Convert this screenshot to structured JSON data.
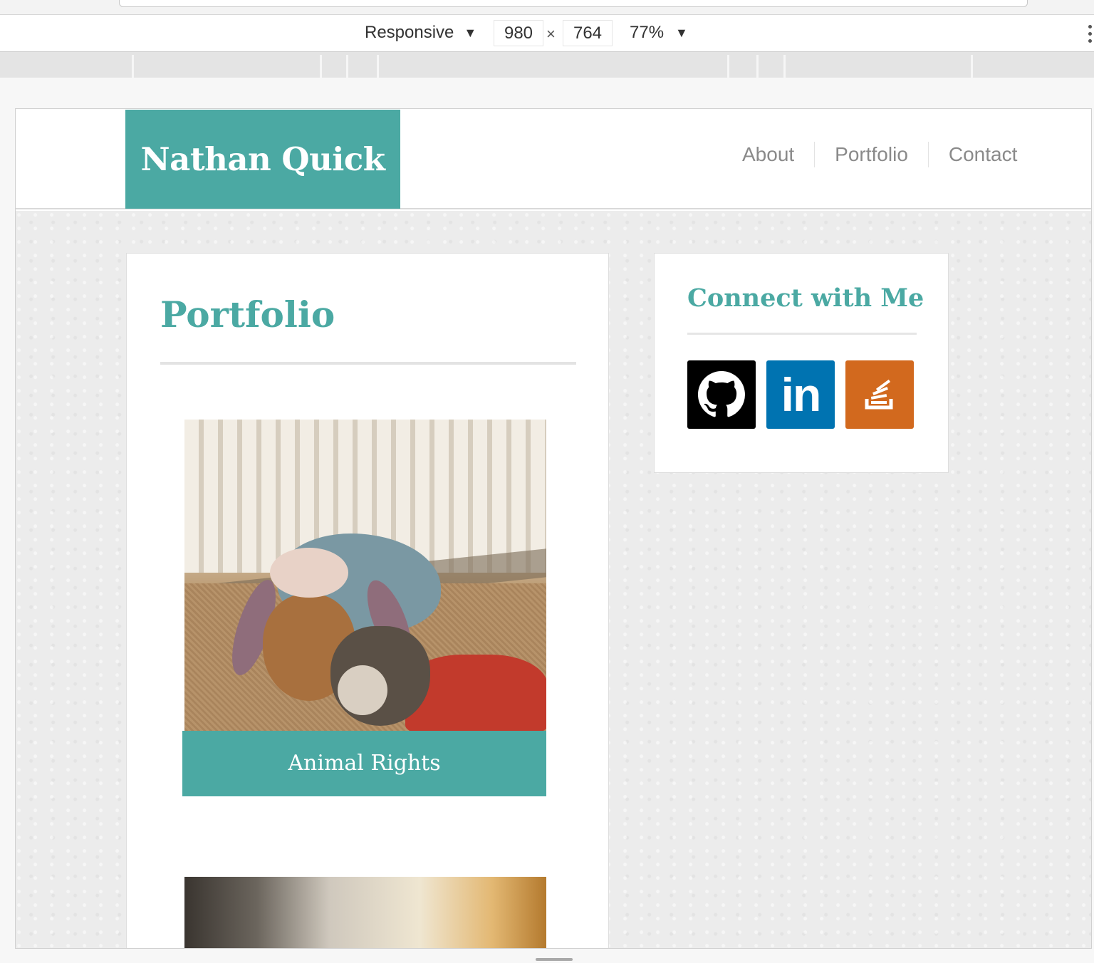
{
  "devtools": {
    "device": "Responsive",
    "width": "980",
    "times": "×",
    "height": "764",
    "zoom": "77%",
    "caret": "▼"
  },
  "site": {
    "brand": "Nathan Quick",
    "nav": [
      {
        "label": "About"
      },
      {
        "label": "Portfolio"
      },
      {
        "label": "Contact"
      }
    ],
    "portfolio": {
      "title": "Portfolio",
      "projects": [
        {
          "caption": "Animal Rights"
        }
      ]
    },
    "connect": {
      "title": "Connect with Me",
      "links": [
        {
          "icon": "github-icon"
        },
        {
          "icon": "linkedin-icon",
          "glyph": "in"
        },
        {
          "icon": "stackoverflow-icon"
        }
      ]
    },
    "colors": {
      "accent": "#4ba9a3",
      "github": "#000000",
      "linkedin": "#0073b1",
      "stackoverflow": "#d2691e"
    }
  }
}
